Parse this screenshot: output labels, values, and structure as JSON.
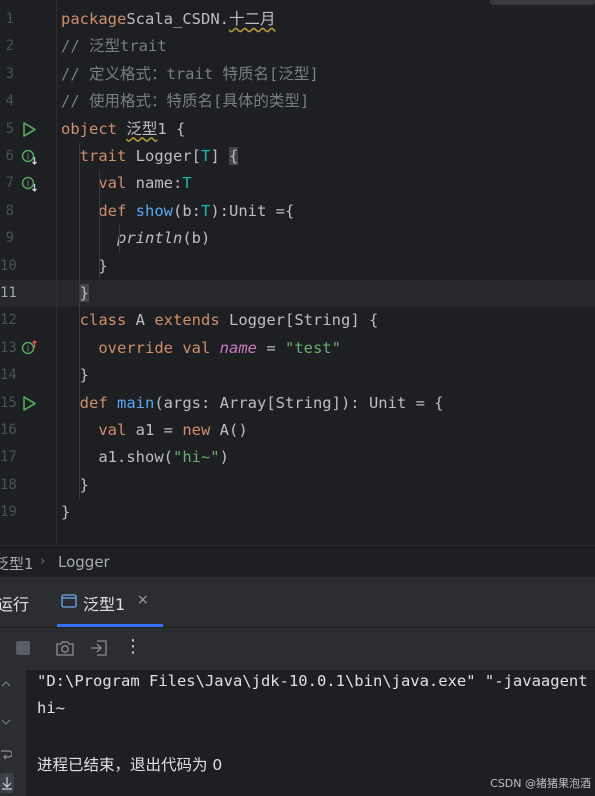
{
  "editor": {
    "lines": [
      {
        "num": "1",
        "tokens": [
          [
            "kw",
            "package"
          ],
          [
            "",
            "Scala_CSDN."
          ],
          [
            "typo",
            "十二月"
          ]
        ]
      },
      {
        "num": "2",
        "tokens": [
          [
            "cm",
            "// 泛型trait"
          ]
        ]
      },
      {
        "num": "3",
        "tokens": [
          [
            "cm",
            "// 定义格式：trait 特质名[泛型]"
          ]
        ]
      },
      {
        "num": "4",
        "tokens": [
          [
            "cm",
            "// 使用格式：特质名[具体的类型]"
          ]
        ]
      },
      {
        "num": "5",
        "tokens": [
          [
            "kw",
            "object "
          ],
          [
            "typo",
            "泛型"
          ],
          [
            "",
            "1 {"
          ]
        ]
      },
      {
        "num": "6",
        "tokens": [
          [
            "",
            "  "
          ],
          [
            "kw",
            "trait "
          ],
          [
            "",
            "Logger["
          ],
          [
            "tp",
            "T"
          ],
          [
            "",
            "] "
          ],
          [
            "brace-hl",
            "{"
          ]
        ]
      },
      {
        "num": "7",
        "tokens": [
          [
            "",
            "    "
          ],
          [
            "kw",
            "val "
          ],
          [
            "",
            "name:"
          ],
          [
            "tp",
            "T"
          ]
        ]
      },
      {
        "num": "8",
        "tokens": [
          [
            "",
            "    "
          ],
          [
            "kw",
            "def "
          ],
          [
            "fn",
            "show"
          ],
          [
            "",
            "(b:"
          ],
          [
            "tp",
            "T"
          ],
          [
            "",
            "):Unit ={"
          ]
        ]
      },
      {
        "num": "9",
        "tokens": [
          [
            "",
            "      "
          ],
          [
            "it",
            "println"
          ],
          [
            "",
            "(b)"
          ]
        ]
      },
      {
        "num": "10",
        "tokens": [
          [
            "",
            "    }"
          ]
        ]
      },
      {
        "num": "11",
        "tokens": [
          [
            "",
            "  "
          ],
          [
            "brace-hl",
            "}"
          ]
        ]
      },
      {
        "num": "12",
        "tokens": [
          [
            "",
            "  "
          ],
          [
            "kw",
            "class "
          ],
          [
            "",
            "A "
          ],
          [
            "kw",
            "extends "
          ],
          [
            "",
            "Logger[String] {"
          ]
        ]
      },
      {
        "num": "13",
        "tokens": [
          [
            "",
            "    "
          ],
          [
            "kw",
            "override val "
          ],
          [
            "fld",
            "name"
          ],
          [
            "",
            " = "
          ],
          [
            "st",
            "\"test\""
          ]
        ]
      },
      {
        "num": "14",
        "tokens": [
          [
            "",
            "  }"
          ]
        ]
      },
      {
        "num": "15",
        "tokens": [
          [
            "",
            "  "
          ],
          [
            "kw",
            "def "
          ],
          [
            "fn",
            "main"
          ],
          [
            "",
            "(args: Array[String]): Unit = {"
          ]
        ]
      },
      {
        "num": "16",
        "tokens": [
          [
            "",
            "    "
          ],
          [
            "kw",
            "val "
          ],
          [
            "",
            "a1 = "
          ],
          [
            "kw",
            "new "
          ],
          [
            "",
            "A()"
          ]
        ]
      },
      {
        "num": "17",
        "tokens": [
          [
            "",
            "    a1.show("
          ],
          [
            "st",
            "\"hi~\""
          ],
          [
            "",
            ")"
          ]
        ]
      },
      {
        "num": "18",
        "tokens": [
          [
            "",
            "  }"
          ]
        ]
      },
      {
        "num": "19",
        "tokens": [
          [
            "",
            "}"
          ]
        ]
      }
    ],
    "current_line": "11"
  },
  "breadcrumb": {
    "object": "泛型1",
    "separator": "›",
    "trait": "Logger"
  },
  "run": {
    "title": "运行",
    "tab_label": "泛型1",
    "tab_close": "×",
    "toolbar": [
      "stop-icon",
      "camera-icon",
      "exit-icon",
      "more-icon"
    ],
    "more_label": "⋮",
    "console": [
      "\"D:\\Program Files\\Java\\jdk-10.0.1\\bin\\java.exe\" \"-javaagent",
      "hi~",
      "",
      "进程已结束，退出代码为 0"
    ]
  },
  "watermark": "CSDN @猪猪果泡酒",
  "colors": {
    "editor_bg": "#1e1f22",
    "keyword": "#cf8e6d",
    "comment": "#7a7e85",
    "function": "#56a8f5",
    "type_param": "#16baac",
    "string": "#6aab73",
    "field": "#c77dbb",
    "run_icon": "#57a65c",
    "tab_accent": "#3574f0"
  }
}
